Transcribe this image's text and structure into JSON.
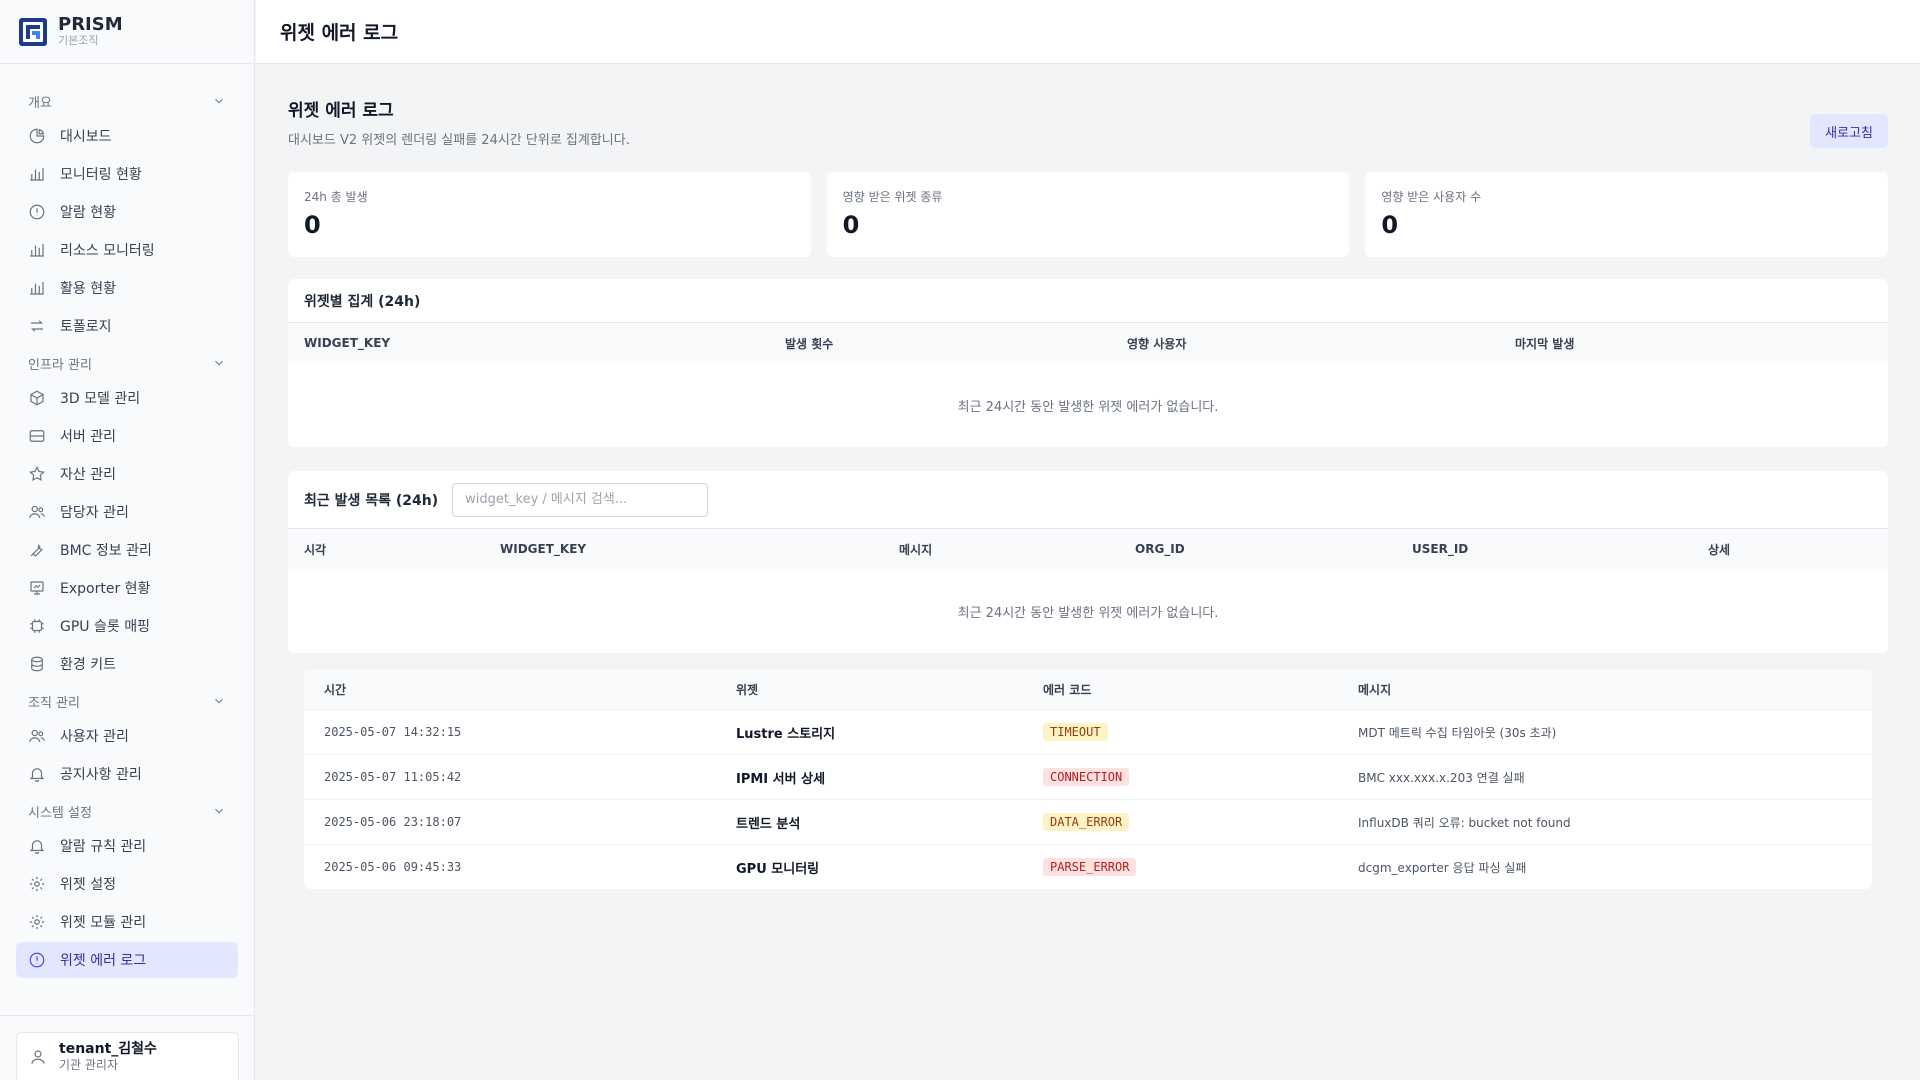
{
  "brand": {
    "name": "PRISM",
    "sub": "기본조직"
  },
  "topbar": {
    "title": "위젯 에러 로그"
  },
  "sidebar": {
    "sections": [
      {
        "label": "개요",
        "items": [
          {
            "label": "대시보드",
            "icon": "pie-chart-icon"
          },
          {
            "label": "모니터링 현황",
            "icon": "bar-chart-icon"
          },
          {
            "label": "알람 현황",
            "icon": "alert-circle-icon"
          },
          {
            "label": "리소스 모니터링",
            "icon": "bar-chart-icon"
          },
          {
            "label": "활용 현황",
            "icon": "bar-chart-icon"
          },
          {
            "label": "토폴로지",
            "icon": "swap-arrows-icon"
          }
        ]
      },
      {
        "label": "인프라 관리",
        "items": [
          {
            "label": "3D 모델 관리",
            "icon": "cube-icon"
          },
          {
            "label": "서버 관리",
            "icon": "server-icon"
          },
          {
            "label": "자산 관리",
            "icon": "star-icon"
          },
          {
            "label": "담당자 관리",
            "icon": "users-icon"
          },
          {
            "label": "BMC 정보 관리",
            "icon": "tool-icon"
          },
          {
            "label": "Exporter 현황",
            "icon": "presentation-icon"
          },
          {
            "label": "GPU 슬롯 매핑",
            "icon": "chip-icon"
          },
          {
            "label": "환경 키트",
            "icon": "database-icon"
          }
        ]
      },
      {
        "label": "조직 관리",
        "items": [
          {
            "label": "사용자 관리",
            "icon": "users-icon"
          },
          {
            "label": "공지사항 관리",
            "icon": "bell-icon"
          }
        ]
      },
      {
        "label": "시스템 설정",
        "items": [
          {
            "label": "알람 규칙 관리",
            "icon": "bell-icon"
          },
          {
            "label": "위젯 설정",
            "icon": "gear-icon"
          },
          {
            "label": "위젯 모듈 관리",
            "icon": "gear-icon"
          },
          {
            "label": "위젯 에러 로그",
            "icon": "alert-circle-icon",
            "active": true
          }
        ]
      }
    ]
  },
  "user": {
    "name": "tenant_김철수",
    "role": "기관 관리자"
  },
  "page": {
    "title": "위젯 에러 로그",
    "description": "대시보드 V2 위젯의 렌더링 실패를 24시간 단위로 집계합니다.",
    "refresh_label": "새로고침"
  },
  "stats": [
    {
      "label": "24h 총 발생",
      "value": "0"
    },
    {
      "label": "영향 받은 위젯 종류",
      "value": "0"
    },
    {
      "label": "영향 받은 사용자 수",
      "value": "0"
    }
  ],
  "summary_table": {
    "title": "위젯별 집계 (24h)",
    "columns": [
      "WIDGET_KEY",
      "발생 횟수",
      "영향 사용자",
      "마지막 발생"
    ],
    "empty": "최근 24시간 동안 발생한 위젯 에러가 없습니다."
  },
  "recent_table": {
    "title": "최근 발생 목록 (24h)",
    "search_placeholder": "widget_key / 메시지 검색...",
    "columns": [
      "시각",
      "WIDGET_KEY",
      "메시지",
      "ORG_ID",
      "USER_ID",
      "상세"
    ],
    "empty": "최근 24시간 동안 발생한 위젯 에러가 없습니다."
  },
  "error_table": {
    "columns": [
      "시간",
      "위젯",
      "에러 코드",
      "메시지"
    ],
    "rows": [
      {
        "time": "2025-05-07 14:32:15",
        "widget": "Lustre 스토리지",
        "code": "TIMEOUT",
        "severity": "warn",
        "message": "MDT 메트릭 수집 타임아웃 (30s 초과)"
      },
      {
        "time": "2025-05-07 11:05:42",
        "widget": "IPMI 서버 상세",
        "code": "CONNECTION",
        "severity": "err",
        "message": "BMC xxx.xxx.x.203 연결 실패"
      },
      {
        "time": "2025-05-06 23:18:07",
        "widget": "트렌드 분석",
        "code": "DATA_ERROR",
        "severity": "warn",
        "message": "InfluxDB 쿼리 오류: bucket not found"
      },
      {
        "time": "2025-05-06 09:45:33",
        "widget": "GPU 모니터링",
        "code": "PARSE_ERROR",
        "severity": "err",
        "message": "dcgm_exporter 응답 파싱 실패"
      }
    ]
  },
  "colors": {
    "accent": "#4f46e5",
    "active_bg": "#e0e7ff",
    "warn_bg": "#fef3c7",
    "err_bg": "#fee2e2"
  }
}
